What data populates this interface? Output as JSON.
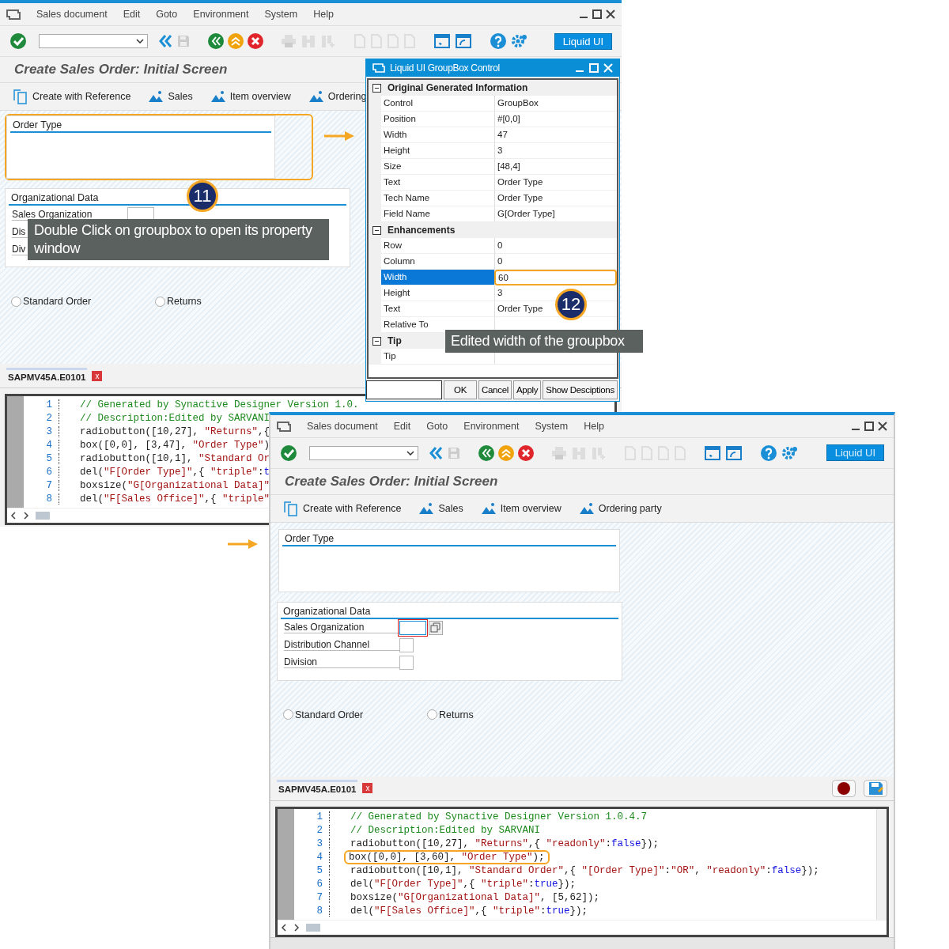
{
  "windows": [
    {
      "menu": [
        "Sales document",
        "Edit",
        "Goto",
        "Environment",
        "System",
        "Help"
      ],
      "liquid_ui_button": "Liquid UI",
      "title": "Create Sales Order: Initial Screen",
      "app_toolbar": [
        {
          "label": "Create with Reference",
          "kind": "reference"
        },
        {
          "label": "Sales",
          "kind": "overview"
        },
        {
          "label": "Item overview",
          "kind": "overview"
        },
        {
          "label": "Ordering",
          "kind": "overview"
        }
      ],
      "groupbox": {
        "title": "Order Type",
        "highlighted": true
      },
      "org_box": {
        "title": "Organizational Data",
        "fields": [
          {
            "label": "Sales Organization"
          },
          {
            "label": "Dis"
          },
          {
            "label": "Div"
          }
        ]
      },
      "radios": [
        {
          "label": "Standard Order",
          "selected": false
        },
        {
          "label": "Returns",
          "selected": false
        }
      ],
      "editor_tab": {
        "label": "SAPMV45A.E0101",
        "close": "x"
      },
      "code": [
        {
          "number": "1",
          "highlighted": false,
          "tokens": [
            {
              "kind": "comment",
              "text": "// Generated by Synactive Designer Version 1.0."
            }
          ]
        },
        {
          "number": "2",
          "highlighted": false,
          "tokens": [
            {
              "kind": "comment",
              "text": "// Description:Edited by SARVANI"
            }
          ]
        },
        {
          "number": "3",
          "highlighted": false,
          "tokens": [
            {
              "kind": "plain",
              "text": "radiobutton([10,27], "
            },
            {
              "kind": "string",
              "text": "\"Returns\""
            },
            {
              "kind": "plain",
              "text": ",{"
            }
          ]
        },
        {
          "number": "4",
          "highlighted": false,
          "tokens": [
            {
              "kind": "plain",
              "text": "box([0,0], [3,47], "
            },
            {
              "kind": "string",
              "text": "\"Order Type\""
            },
            {
              "kind": "plain",
              "text": ")"
            }
          ]
        },
        {
          "number": "5",
          "highlighted": false,
          "tokens": [
            {
              "kind": "plain",
              "text": "radiobutton([10,1], "
            },
            {
              "kind": "string",
              "text": "\"Standard Or"
            }
          ]
        },
        {
          "number": "6",
          "highlighted": false,
          "tokens": [
            {
              "kind": "plain",
              "text": "del("
            },
            {
              "kind": "string",
              "text": "\"F[Order Type]\""
            },
            {
              "kind": "plain",
              "text": ",{ "
            },
            {
              "kind": "string",
              "text": "\"triple\""
            },
            {
              "kind": "plain",
              "text": ":"
            },
            {
              "kind": "keyword",
              "text": "t"
            }
          ]
        },
        {
          "number": "7",
          "highlighted": false,
          "tokens": [
            {
              "kind": "plain",
              "text": "boxsize("
            },
            {
              "kind": "string",
              "text": "\"G[Organizational Data]\""
            }
          ]
        },
        {
          "number": "8",
          "highlighted": false,
          "tokens": [
            {
              "kind": "plain",
              "text": "del("
            },
            {
              "kind": "string",
              "text": "\"F[Sales Office]\""
            },
            {
              "kind": "plain",
              "text": ",{ "
            },
            {
              "kind": "string",
              "text": "\"triple\""
            }
          ]
        }
      ],
      "tooltip": "Double Click on groupbox to open its property window",
      "step": "11"
    },
    {
      "menu": [
        "Sales document",
        "Edit",
        "Goto",
        "Environment",
        "System",
        "Help"
      ],
      "liquid_ui_button": "Liquid UI",
      "title": "Create Sales Order: Initial Screen",
      "app_toolbar": [
        {
          "label": "Create with Reference",
          "kind": "reference"
        },
        {
          "label": "Sales",
          "kind": "overview"
        },
        {
          "label": "Item overview",
          "kind": "overview"
        },
        {
          "label": "Ordering party",
          "kind": "overview"
        }
      ],
      "groupbox": {
        "title": "Order Type",
        "highlighted": false
      },
      "org_box": {
        "title": "Organizational Data",
        "fields": [
          {
            "label": "Sales Organization",
            "focused": true
          },
          {
            "label": "Distribution Channel",
            "focused": false
          },
          {
            "label": "Division",
            "focused": false
          }
        ]
      },
      "radios": [
        {
          "label": "Standard Order",
          "selected": false
        },
        {
          "label": "Returns",
          "selected": false
        }
      ],
      "editor_tab": {
        "label": "SAPMV45A.E0101",
        "close": "x"
      },
      "code": [
        {
          "number": "1",
          "highlighted": false,
          "tokens": [
            {
              "kind": "comment",
              "text": "// Generated by Synactive Designer Version 1.0.4.7"
            }
          ]
        },
        {
          "number": "2",
          "highlighted": false,
          "tokens": [
            {
              "kind": "comment",
              "text": "// Description:Edited by SARVANI"
            }
          ]
        },
        {
          "number": "3",
          "highlighted": false,
          "tokens": [
            {
              "kind": "plain",
              "text": "radiobutton([10,27], "
            },
            {
              "kind": "string",
              "text": "\"Returns\""
            },
            {
              "kind": "plain",
              "text": ",{ "
            },
            {
              "kind": "string",
              "text": "\"readonly\""
            },
            {
              "kind": "plain",
              "text": ":"
            },
            {
              "kind": "keyword",
              "text": "false"
            },
            {
              "kind": "plain",
              "text": "});"
            }
          ]
        },
        {
          "number": "4",
          "highlighted": true,
          "tokens": [
            {
              "kind": "plain",
              "text": "box([0,0], [3,60], "
            },
            {
              "kind": "string",
              "text": "\"Order Type\""
            },
            {
              "kind": "plain",
              "text": ");"
            }
          ]
        },
        {
          "number": "5",
          "highlighted": false,
          "tokens": [
            {
              "kind": "plain",
              "text": "radiobutton([10,1], "
            },
            {
              "kind": "string",
              "text": "\"Standard Order\""
            },
            {
              "kind": "plain",
              "text": ",{ "
            },
            {
              "kind": "string",
              "text": "\"[Order Type]\""
            },
            {
              "kind": "plain",
              "text": ":"
            },
            {
              "kind": "string",
              "text": "\"OR\""
            },
            {
              "kind": "plain",
              "text": ", "
            },
            {
              "kind": "string",
              "text": "\"readonly\""
            },
            {
              "kind": "plain",
              "text": ":"
            },
            {
              "kind": "keyword",
              "text": "false"
            },
            {
              "kind": "plain",
              "text": "});"
            }
          ]
        },
        {
          "number": "6",
          "highlighted": false,
          "tokens": [
            {
              "kind": "plain",
              "text": "del("
            },
            {
              "kind": "string",
              "text": "\"F[Order Type]\""
            },
            {
              "kind": "plain",
              "text": ",{ "
            },
            {
              "kind": "string",
              "text": "\"triple\""
            },
            {
              "kind": "plain",
              "text": ":"
            },
            {
              "kind": "keyword",
              "text": "true"
            },
            {
              "kind": "plain",
              "text": "});"
            }
          ]
        },
        {
          "number": "7",
          "highlighted": false,
          "tokens": [
            {
              "kind": "plain",
              "text": "boxsize("
            },
            {
              "kind": "string",
              "text": "\"G[Organizational Data]\""
            },
            {
              "kind": "plain",
              "text": ", [5,62]);"
            }
          ]
        },
        {
          "number": "8",
          "highlighted": false,
          "tokens": [
            {
              "kind": "plain",
              "text": "del("
            },
            {
              "kind": "string",
              "text": "\"F[Sales Office]\""
            },
            {
              "kind": "plain",
              "text": ",{ "
            },
            {
              "kind": "string",
              "text": "\"triple\""
            },
            {
              "kind": "plain",
              "text": ":"
            },
            {
              "kind": "keyword",
              "text": "true"
            },
            {
              "kind": "plain",
              "text": "});"
            }
          ]
        }
      ]
    }
  ],
  "dialog": {
    "title": "Liquid UI GroupBox Control",
    "sections": [
      {
        "title": "Original Generated Information",
        "rows": [
          {
            "label": "Control",
            "value": "GroupBox",
            "selected": false,
            "edited": false
          },
          {
            "label": "Position",
            "value": "#[0,0]",
            "selected": false,
            "edited": false
          },
          {
            "label": "Width",
            "value": "47",
            "selected": false,
            "edited": false
          },
          {
            "label": "Height",
            "value": "3",
            "selected": false,
            "edited": false
          },
          {
            "label": "Size",
            "value": "[48,4]",
            "selected": false,
            "edited": false
          },
          {
            "label": "Text",
            "value": "Order Type",
            "selected": false,
            "edited": false
          },
          {
            "label": "Tech Name",
            "value": "Order Type",
            "selected": false,
            "edited": false
          },
          {
            "label": "Field Name",
            "value": "G[Order Type]",
            "selected": false,
            "edited": false
          }
        ]
      },
      {
        "title": "Enhancements",
        "rows": [
          {
            "label": "Row",
            "value": "0",
            "selected": false,
            "edited": false
          },
          {
            "label": "Column",
            "value": "0",
            "selected": false,
            "edited": false
          },
          {
            "label": "Width",
            "value": "60",
            "selected": true,
            "edited": true
          },
          {
            "label": "Height",
            "value": "3",
            "selected": false,
            "edited": false
          },
          {
            "label": "Text",
            "value": "Order Type",
            "selected": false,
            "edited": false
          },
          {
            "label": "Relative To",
            "selected": false,
            "edited": false
          }
        ]
      },
      {
        "title": "Tip",
        "rows": [
          {
            "label": "Tip",
            "selected": false,
            "edited": false
          }
        ]
      }
    ],
    "buttons": [
      "OK",
      "Cancel",
      "Apply",
      "Show Desciptions"
    ],
    "tooltip": "Edited width of the groupbox",
    "step": "12"
  }
}
